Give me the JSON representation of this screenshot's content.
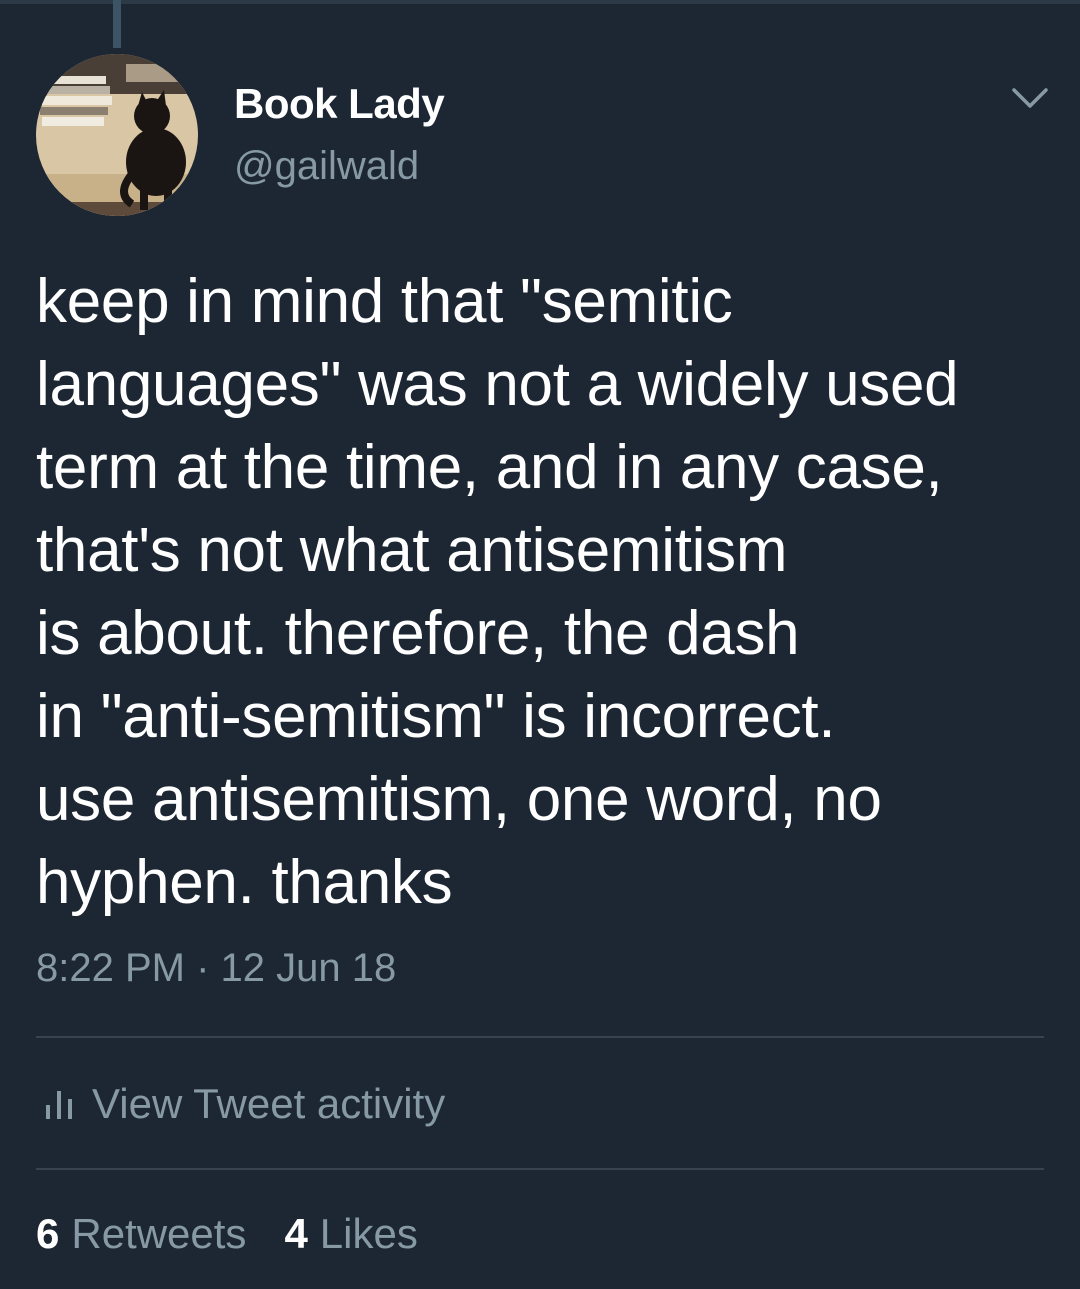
{
  "author": {
    "display_name": "Book Lady",
    "handle": "@gailwald",
    "avatar_icon": "profile-photo-cat-on-books"
  },
  "tweet": {
    "text_lines": [
      "keep in mind that \"semitic",
      "languages\" was not a widely used",
      "term at the time, and in any case,",
      "that's not what antisemitism",
      "is about. therefore, the dash",
      "in \"anti-semitism\" is incorrect.",
      "use antisemitism, one word, no",
      "hyphen. thanks"
    ],
    "timestamp": "8:22 PM · 12 Jun 18"
  },
  "activity": {
    "icon": "bar-chart-icon",
    "label": "View Tweet activity"
  },
  "stats": {
    "retweets_count": "6",
    "retweets_label": "Retweets",
    "likes_count": "4",
    "likes_label": "Likes"
  },
  "menu": {
    "icon": "chevron-down-icon"
  },
  "colors": {
    "background": "#1c2733",
    "text_primary": "#ffffff",
    "text_secondary": "#8899a6",
    "divider": "#38444d",
    "thread_line": "#3d5466"
  }
}
